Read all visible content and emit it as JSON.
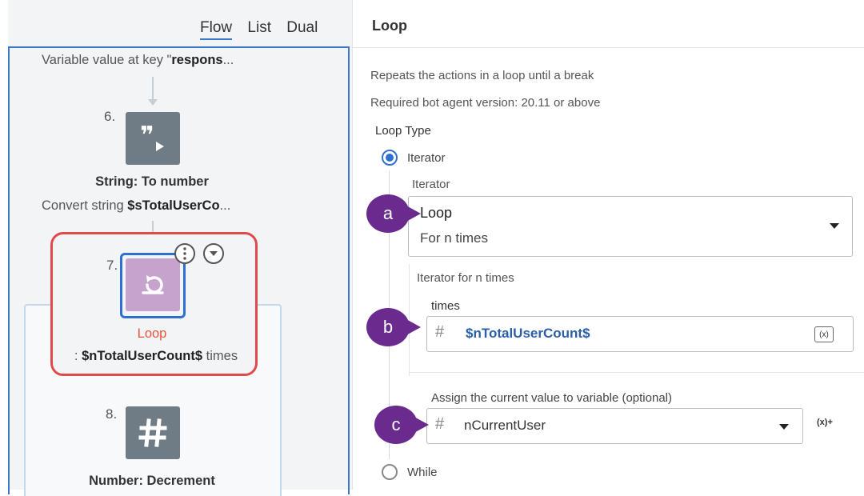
{
  "view_tabs": [
    "Flow",
    "List",
    "Dual"
  ],
  "flow": {
    "prev_step_desc_prefix": "Variable value at key \"",
    "prev_step_desc_bold": "respons",
    "prev_step_desc_suffix": "...",
    "step6": {
      "number": "6.",
      "title": "String: To number",
      "desc_prefix": "Convert string ",
      "desc_bold": "$sTotalUserCo",
      "desc_suffix": "..."
    },
    "step7": {
      "number": "7.",
      "title": "Loop",
      "desc_prefix": ": ",
      "desc_bold": "$nTotalUserCount$",
      "desc_suffix": " times"
    },
    "step8": {
      "number": "8.",
      "title": "Number: Decrement"
    }
  },
  "panel": {
    "title": "Loop",
    "description": "Repeats the actions in a loop until a break",
    "required_version": "Required bot agent version: 20.11 or above",
    "loop_type_label": "Loop Type",
    "option_iterator": "Iterator",
    "option_while": "While",
    "iterator_label": "Iterator",
    "iterator_value_line1": "Loop",
    "iterator_value_line2": "For n times",
    "iterator_for_label": "Iterator for n times",
    "times_label": "times",
    "times_value": "$nTotalUserCount$",
    "assign_label": "Assign the current value to variable (optional)",
    "assign_value": "nCurrentUser",
    "var_button": "(x)",
    "var_add_button": "(x)+"
  },
  "badges": [
    "a",
    "b",
    "c"
  ],
  "colors": {
    "accent_blue": "#3b78c8",
    "highlight_red": "#e04a4a",
    "badge_purple": "#6a2a8e",
    "loop_tile": "#c5a3cc",
    "tile_gray": "#6f7c85",
    "loop_title_orange": "#e8533b"
  }
}
